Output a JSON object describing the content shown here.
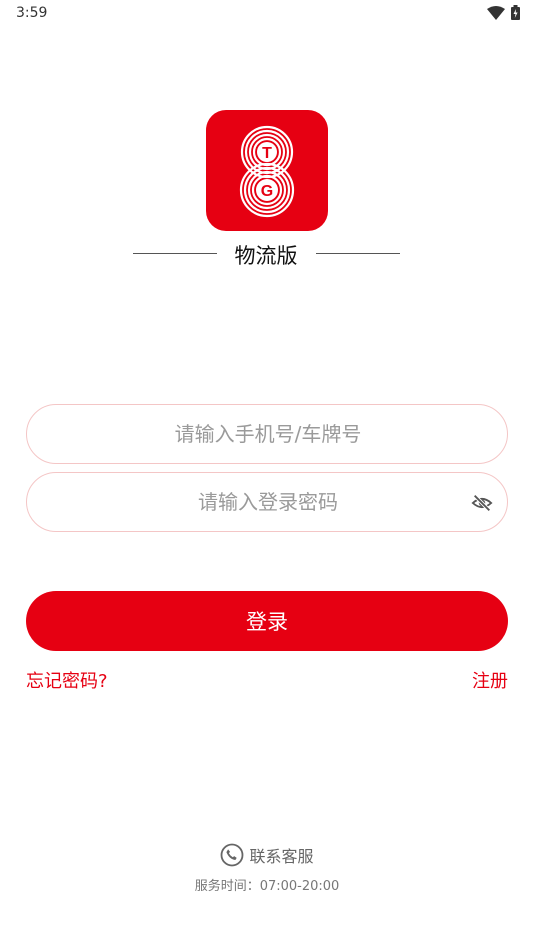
{
  "status_bar": {
    "time": "3:59"
  },
  "brand": {
    "logo_letters": [
      "T",
      "G"
    ],
    "subtitle": "物流版",
    "color": "#e60012"
  },
  "form": {
    "phone_placeholder": "请输入手机号/车牌号",
    "password_placeholder": "请输入登录密码",
    "password_visibility_icon": "eye-off-icon"
  },
  "actions": {
    "login_label": "登录",
    "forgot_label": "忘记密码?",
    "register_label": "注册"
  },
  "footer": {
    "contact_icon": "phone-icon",
    "contact_label": "联系客服",
    "hours": "服务时间：07:00-20:00"
  }
}
